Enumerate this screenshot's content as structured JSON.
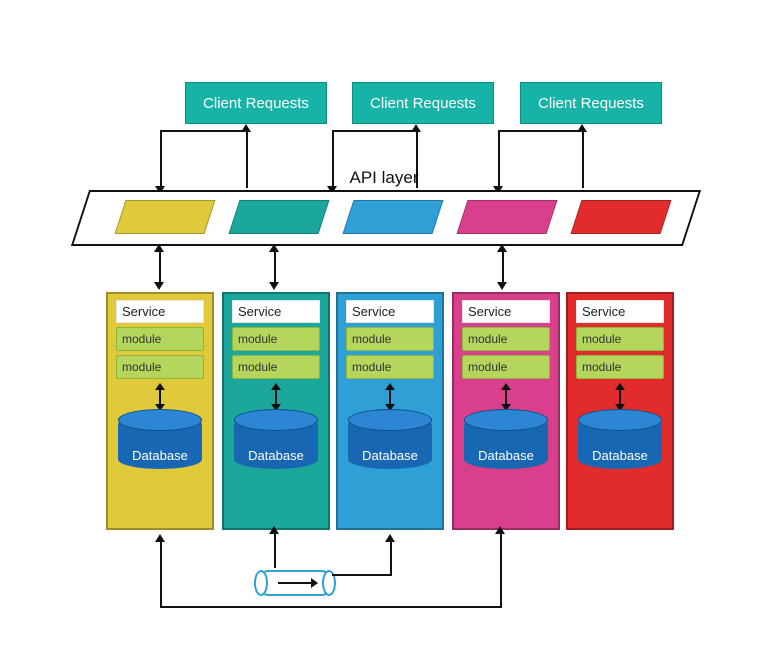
{
  "clients": [
    {
      "label": "Client Requests"
    },
    {
      "label": "Client Requests"
    },
    {
      "label": "Client Requests"
    }
  ],
  "api": {
    "label": "API layer"
  },
  "chips": [
    {
      "color": "#e1c93c"
    },
    {
      "color": "#1ba79c"
    },
    {
      "color": "#2ea0d6"
    },
    {
      "color": "#d93f8a"
    },
    {
      "color": "#e22b2b"
    }
  ],
  "services": [
    {
      "title": "Service",
      "modules": [
        "module",
        "module"
      ],
      "db": "Database",
      "color": "#e1c93c",
      "stacked": true
    },
    {
      "title": "Service",
      "modules": [
        "module",
        "module"
      ],
      "db": "Database",
      "color": "#1ba79c",
      "stacked": false
    },
    {
      "title": "Service",
      "modules": [
        "module",
        "module"
      ],
      "db": "Database",
      "color": "#2ea0d6",
      "stacked": true
    },
    {
      "title": "Service",
      "modules": [
        "module",
        "module"
      ],
      "db": "Database",
      "color": "#d93f8a",
      "stacked": false
    },
    {
      "title": "Service",
      "modules": [
        "module",
        "module"
      ],
      "db": "Database",
      "color": "#e22b2b",
      "stacked": false
    }
  ]
}
